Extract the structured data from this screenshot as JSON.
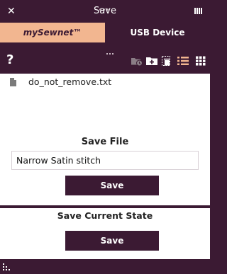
{
  "window": {
    "title": "Save"
  },
  "tabs": [
    {
      "label": "mySewnet™",
      "active": true
    },
    {
      "label": "USB Device",
      "active": false
    }
  ],
  "toolbar": {
    "help": "?",
    "icons": [
      "history-folder-icon",
      "new-folder-icon",
      "delete-icon",
      "list-view-icon",
      "grid-view-icon"
    ]
  },
  "files": [
    {
      "name": "do_not_remove.txt"
    }
  ],
  "save_file": {
    "label": "Save File",
    "filename_value": "Narrow Satin stitch",
    "button": "Save"
  },
  "save_state": {
    "label": "Save Current State",
    "button": "Save"
  },
  "colors": {
    "primary": "#3b1a33",
    "tab_active": "#f2b690",
    "panel": "#ffffff"
  }
}
